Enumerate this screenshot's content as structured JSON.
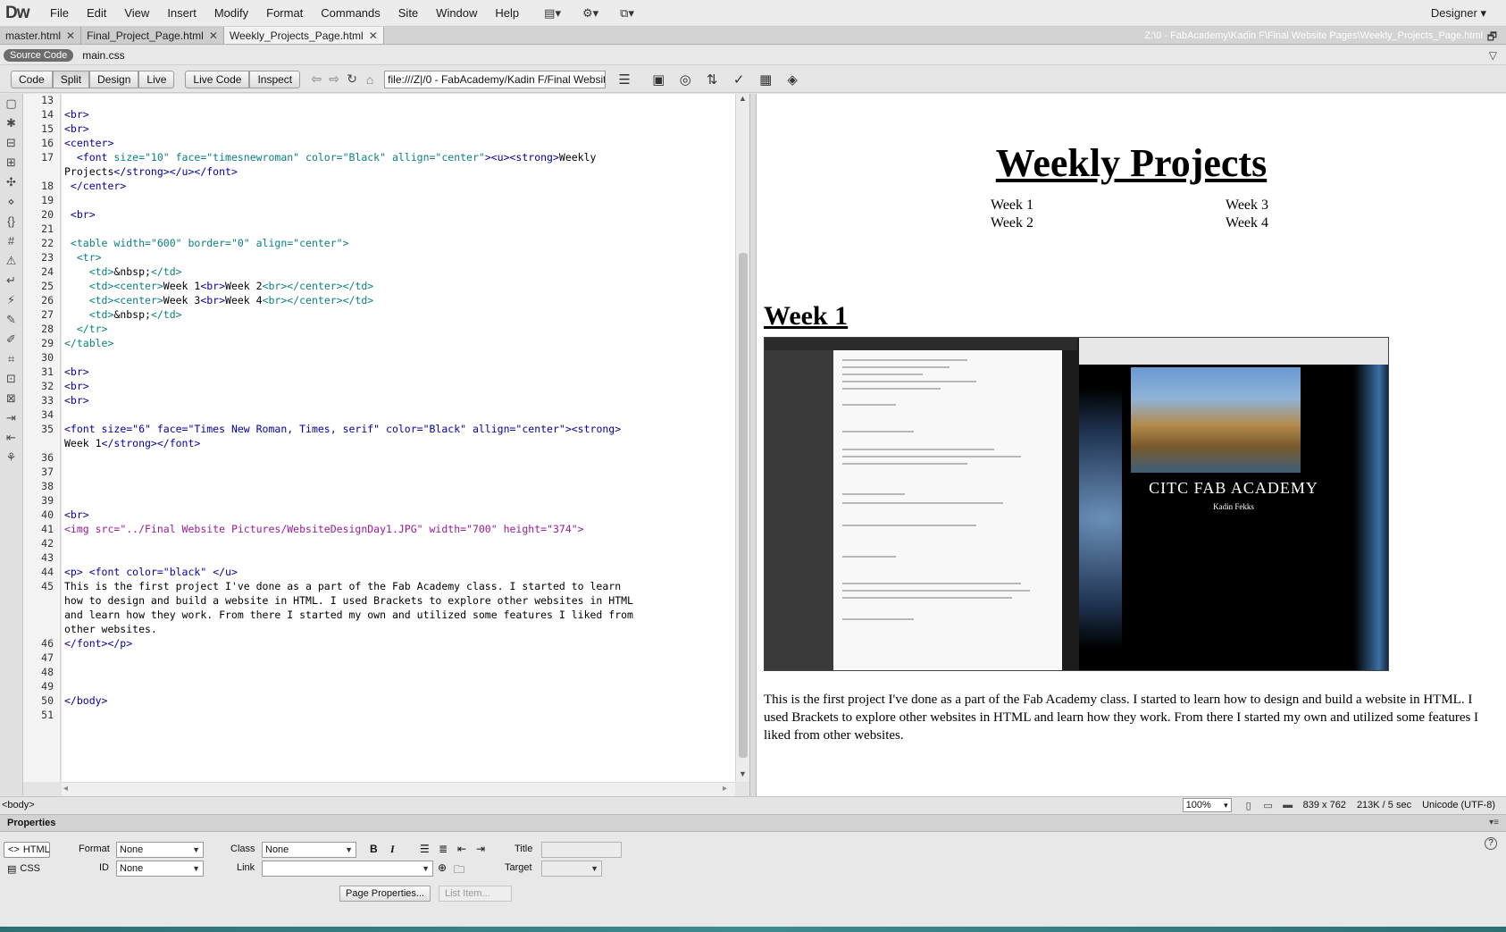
{
  "app": {
    "logo": "Dw",
    "menu": [
      "File",
      "Edit",
      "View",
      "Insert",
      "Modify",
      "Format",
      "Commands",
      "Site",
      "Window",
      "Help"
    ],
    "workspace": "Designer",
    "workspace_arrow": "▾"
  },
  "tabs": [
    {
      "label": "master.html",
      "close": "✕"
    },
    {
      "label": "Final_Project_Page.html",
      "close": "✕"
    },
    {
      "label": "Weekly_Projects_Page.html",
      "close": "✕"
    }
  ],
  "document_path": "Z:\\0 - FabAcademy\\Kadin F\\Final Website Pages\\Weekly_Projects_Page.html",
  "related_files": {
    "source_code": "Source Code",
    "css_file": "main.css"
  },
  "toolbar": {
    "code": "Code",
    "split": "Split",
    "design": "Design",
    "live": "Live",
    "live_code": "Live Code",
    "inspect": "Inspect",
    "address": "file:///Z|/0 - FabAcademy/Kadin F/Final Websit"
  },
  "code": {
    "line_numbers": [
      "13",
      "14",
      "15",
      "16",
      "17",
      "18",
      "19",
      "20",
      "21",
      "22",
      "23",
      "24",
      "25",
      "26",
      "27",
      "28",
      "29",
      "30",
      "31",
      "32",
      "33",
      "34",
      "35",
      "36",
      "37",
      "38",
      "39",
      "40",
      "41",
      "42",
      "43",
      "44",
      "45",
      "46",
      "47",
      "48",
      "49",
      "50",
      "51"
    ],
    "lines": {
      "l14": "<br>",
      "l15": "<br>",
      "l16": "<center>",
      "l17a_tag": "  <font ",
      "l17a_attr": "size=\"10\" face=\"timesnewroman\" color=\"Black\" allign=\"center\"",
      "l17a_tags2": "><u><strong>",
      "l17a_text": "Weekly",
      "l17b_text": "Projects",
      "l17b_tags": "</strong></u></font>",
      "l18": " </center>",
      "l20": " <br>",
      "l22_tag": " <table ",
      "l22_attr": "width=\"600\" border=\"0\" align=\"center\"",
      "l22_end": ">",
      "l23": "  <tr>",
      "l24_tag": "    <td>",
      "l24_text": "&nbsp;",
      "l24_end": "</td>",
      "l25_tags": "    <td><center>",
      "l25_t1": "Week 1",
      "l25_br": "<br>",
      "l25_t2": "Week 2",
      "l25_end": "<br></center></td>",
      "l26_tags": "    <td><center>",
      "l26_t1": "Week 3",
      "l26_br": "<br>",
      "l26_t2": "Week 4",
      "l26_end": "<br></center></td>",
      "l27_tag": "    <td>",
      "l27_text": "&nbsp;",
      "l27_end": "</td>",
      "l28": "  </tr>",
      "l29": "</table>",
      "l31": "<br>",
      "l32": "<br>",
      "l33": "<br>",
      "l35_tag": "<font ",
      "l35_attr": "size=\"6\" face=\"Times New Roman, Times, serif\" color=\"Black\" allign=\"center\"",
      "l35_end": "><strong>",
      "l35b_text": "Week 1",
      "l35b_tags": "</strong></font>",
      "l40": "<br>",
      "l41_tag": "<img ",
      "l41_attr": "src=\"../Final Website Pictures/WebsiteDesignDay1.JPG\" width=\"700\" height=\"374\"",
      "l41_end": ">",
      "l44_tags": "<p> <font ",
      "l44_attr": "color=\"black\"",
      "l44_end": " </u>",
      "l45a": "This is the first project I've done as a part of the Fab Academy class. I started to learn",
      "l45b": "how to design and build a website in HTML. I used Brackets to explore other websites in HTML",
      "l45c": "and learn how they work. From there I started my own and utilized some features I liked from",
      "l45d": "other websites.",
      "l46": "</font></p>",
      "l50": "</body>"
    }
  },
  "design_view": {
    "title": "Weekly Projects",
    "weeks": [
      "Week 1",
      "Week 2",
      "Week 3",
      "Week 4"
    ],
    "section_heading": "Week 1",
    "screenshot_caption": "CITC FAB ACADEMY",
    "screenshot_subcaption": "Kadin Fekks",
    "paragraph": "This is the first project I've done as a part of the Fab Academy class. I started to learn how to design and build a website in HTML. I used Brackets to explore other websites in HTML and learn how they work. From there I started my own and utilized some features I liked from other websites."
  },
  "status_bar": {
    "tag_selector": "<body>",
    "zoom": "100%",
    "window_size": "839 x 762",
    "download": "213K / 5 sec",
    "encoding": "Unicode (UTF-8)"
  },
  "properties": {
    "header": "Properties",
    "html_tab": "HTML",
    "css_tab": "CSS",
    "format_label": "Format",
    "format_value": "None",
    "id_label": "ID",
    "id_value": "None",
    "class_label": "Class",
    "class_value": "None",
    "link_label": "Link",
    "link_value": "",
    "title_label": "Title",
    "target_label": "Target",
    "bold": "B",
    "italic": "I",
    "page_properties": "Page Properties...",
    "list_item": "List Item..."
  }
}
